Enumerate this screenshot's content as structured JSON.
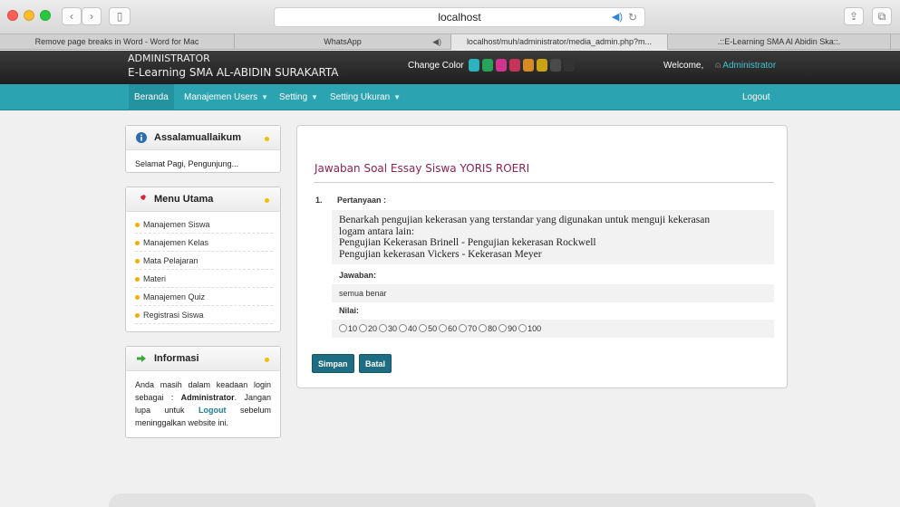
{
  "browser": {
    "address": "localhost",
    "tabs": [
      {
        "title": "Remove page breaks in Word - Word for Mac"
      },
      {
        "title": "WhatsApp"
      },
      {
        "title": "localhost/muh/administrator/media_admin.php?m..."
      },
      {
        "title": ".::E-Learning SMA Al Abidin Ska::."
      }
    ]
  },
  "header": {
    "role": "ADMINISTRATOR",
    "site": "E-Learning SMA AL-ABIDIN SURAKARTA",
    "change_color": "Change Color",
    "swatches": [
      "#2bb3c0",
      "#27a35a",
      "#d2338f",
      "#c63358",
      "#d98a24",
      "#caa314",
      "#4a4a4a",
      "#333333"
    ],
    "welcome": "Welcome,",
    "user": "Administrator"
  },
  "menu": {
    "items": [
      {
        "label": "Beranda"
      },
      {
        "label": "Manajemen Users"
      },
      {
        "label": "Setting"
      },
      {
        "label": "Setting Ukuran"
      }
    ],
    "logout": "Logout"
  },
  "sidebar": {
    "greeting": {
      "title": "Assalamuallaikum",
      "text": "Selamat Pagi, Pengunjung..."
    },
    "main_menu": {
      "title": "Menu Utama",
      "items": [
        "Manajemen Siswa",
        "Manajemen Kelas",
        "Mata Pelajaran",
        "Materi",
        "Manajemen Quiz",
        "Registrasi Siswa"
      ]
    },
    "info": {
      "title": "Informasi",
      "line1": "Anda masih dalam keadaan login sebagai :",
      "role": "Administrator",
      "line2": "Jangan lupa untuk",
      "logout": "Logout",
      "line3": "sebelum meninggalkan website ini."
    }
  },
  "main": {
    "title": "Jawaban Soal Essay Siswa YORIS ROERI",
    "number": "1.",
    "question_label": "Pertanyaan :",
    "question_lines": [
      "Benarkah pengujian kekerasan yang terstandar yang digunakan untuk menguji kekerasan",
      "logam antara lain:",
      "Pengujian Kekerasan Brinell - Pengujian kekerasan Rockwell",
      "Pengujian kekerasan Vickers - Kekerasan Meyer"
    ],
    "answer_label": "Jawaban:",
    "answer": "semua benar",
    "score_label": "Nilai:",
    "scores": [
      "10",
      "20",
      "30",
      "40",
      "50",
      "60",
      "70",
      "80",
      "90",
      "100"
    ],
    "save": "Simpan",
    "cancel": "Batal"
  }
}
